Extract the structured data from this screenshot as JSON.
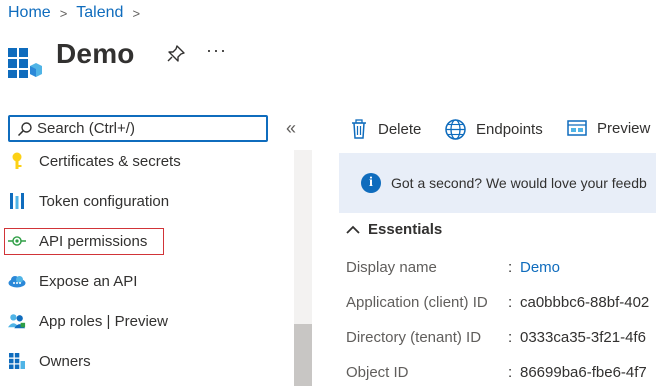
{
  "breadcrumb": {
    "home": "Home",
    "parent": "Talend",
    "sep": ">"
  },
  "header": {
    "title": "Demo",
    "more": "···"
  },
  "search": {
    "placeholder": "Search (Ctrl+/)",
    "collapse": "«"
  },
  "sidebar": {
    "items": [
      {
        "label": "Certificates & secrets",
        "icon": "key-icon"
      },
      {
        "label": "Token configuration",
        "icon": "token-bars-icon"
      },
      {
        "label": "API permissions",
        "icon": "api-permissions-icon",
        "selected": true
      },
      {
        "label": "Expose an API",
        "icon": "cloud-icon"
      },
      {
        "label": "App roles | Preview",
        "icon": "people-icon"
      },
      {
        "label": "Owners",
        "icon": "grid-icon"
      }
    ]
  },
  "toolbar": {
    "delete": "Delete",
    "endpoints": "Endpoints",
    "preview": "Preview"
  },
  "banner": {
    "text": "Got a second? We would love your feedb"
  },
  "essentials": {
    "title": "Essentials",
    "rows": [
      {
        "label": "Display name",
        "value": "Demo"
      },
      {
        "label": "Application (client) ID",
        "value": "ca0bbbc6-88bf-402"
      },
      {
        "label": "Directory (tenant) ID",
        "value": "0333ca35-3f21-4f6"
      },
      {
        "label": "Object ID",
        "value": "86699ba6-fbe6-4f7"
      }
    ],
    "colon": ":"
  },
  "colors": {
    "accent": "#0f6cbd",
    "highlight": "#d13438",
    "banner_bg": "#e8eef8"
  }
}
